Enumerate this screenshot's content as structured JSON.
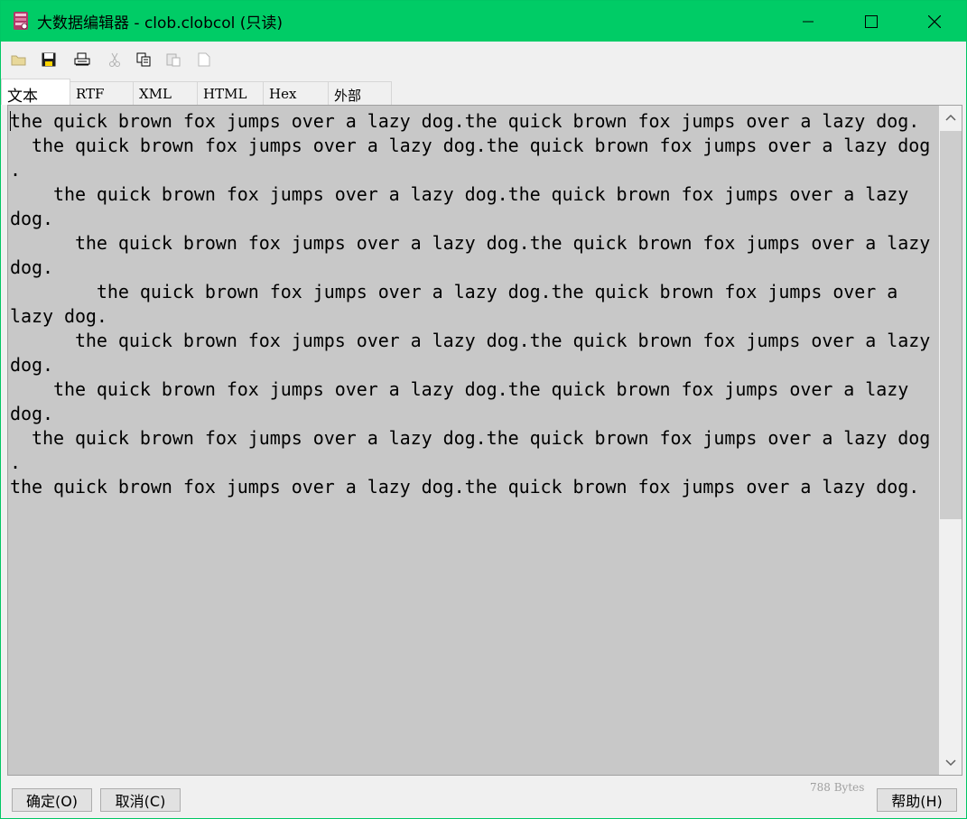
{
  "window": {
    "title": "大数据编辑器 - clob.clobcol (只读)"
  },
  "icons": {
    "app": "app-icon",
    "toolbar": [
      "open-folder-icon",
      "save-icon",
      "print-icon",
      "cut-icon",
      "copy-icon",
      "paste-icon",
      "clear-icon"
    ]
  },
  "tabs": [
    {
      "label": "文本"
    },
    {
      "label": "RTF"
    },
    {
      "label": "XML"
    },
    {
      "label": "HTML"
    },
    {
      "label": "Hex"
    },
    {
      "label": "外部"
    }
  ],
  "editor": {
    "text": "the quick brown fox jumps over a lazy dog.the quick brown fox jumps over a lazy dog.\n  the quick brown fox jumps over a lazy dog.the quick brown fox jumps over a lazy dog\n.\n    the quick brown fox jumps over a lazy dog.the quick brown fox jumps over a lazy\ndog.\n      the quick brown fox jumps over a lazy dog.the quick brown fox jumps over a lazy\ndog.\n        the quick brown fox jumps over a lazy dog.the quick brown fox jumps over a\nlazy dog.\n      the quick brown fox jumps over a lazy dog.the quick brown fox jumps over a lazy\ndog.\n    the quick brown fox jumps over a lazy dog.the quick brown fox jumps over a lazy\ndog.\n  the quick brown fox jumps over a lazy dog.the quick brown fox jumps over a lazy dog\n.\nthe quick brown fox jumps over a lazy dog.the quick brown fox jumps over a lazy dog."
  },
  "status": {
    "byte_count": "788 Bytes"
  },
  "buttons": {
    "ok": "确定(O)",
    "cancel": "取消(C)",
    "help": "帮助(H)"
  },
  "colors": {
    "titlebar": "#00cc66",
    "editor_bg": "#c8c8c8"
  }
}
